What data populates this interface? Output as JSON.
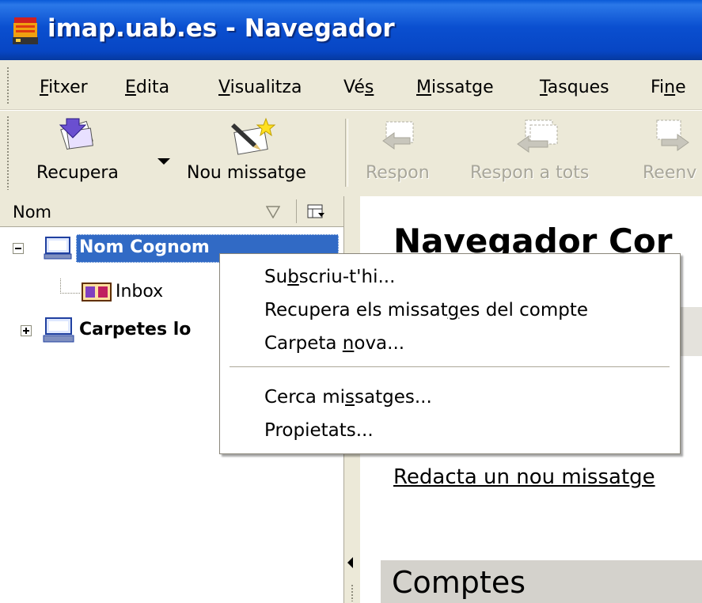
{
  "window": {
    "title": "imap.uab.es - Navegador",
    "icon": "mail-app-icon"
  },
  "menubar": {
    "items": [
      {
        "label": "Fitxer",
        "accel": "F"
      },
      {
        "label": "Edita",
        "accel": "E"
      },
      {
        "label": "Visualitza",
        "accel": "V"
      },
      {
        "label": "Vés",
        "accel": "s"
      },
      {
        "label": "Missatge",
        "accel": "M"
      },
      {
        "label": "Tasques",
        "accel": "T"
      },
      {
        "label": "Fine",
        "accel": "n"
      }
    ]
  },
  "toolbar": {
    "buttons": [
      {
        "label": "Recupera",
        "icon": "get-mail-icon",
        "enabled": true
      },
      {
        "label": "Nou missatge",
        "icon": "new-message-icon",
        "enabled": true
      },
      {
        "label": "Respon",
        "icon": "reply-icon",
        "enabled": false
      },
      {
        "label": "Respon a tots",
        "icon": "reply-all-icon",
        "enabled": false
      },
      {
        "label": "Reenv",
        "icon": "forward-icon",
        "enabled": false
      }
    ]
  },
  "folder_pane": {
    "column_header": "Nom",
    "tree": [
      {
        "label": "Nom Cognom",
        "icon": "account-icon",
        "expanded": true,
        "selected": true
      },
      {
        "label": "Inbox",
        "icon": "inbox-icon"
      },
      {
        "label": "Carpetes lo",
        "icon": "local-folders-icon",
        "expanded": false
      }
    ]
  },
  "content": {
    "title": "Navegador Cor",
    "compose_link": "Redacta un nou missatge",
    "accounts_heading": "Comptes"
  },
  "context_menu": {
    "items": [
      {
        "label": "Subscriu-t'hi...",
        "accel": "b"
      },
      {
        "label": "Recupera els missatges del compte",
        "accel": "g"
      },
      {
        "label": "Carpeta nova...",
        "accel": "n"
      },
      {
        "label": "Cerca missatges...",
        "accel": "s"
      },
      {
        "label": "Propietats...",
        "accel": ""
      }
    ]
  },
  "colors": {
    "titlebar": "#0a4fd0",
    "selection": "#316ac5",
    "chrome": "#ece9d8",
    "disabled_text": "#a8a69a"
  }
}
